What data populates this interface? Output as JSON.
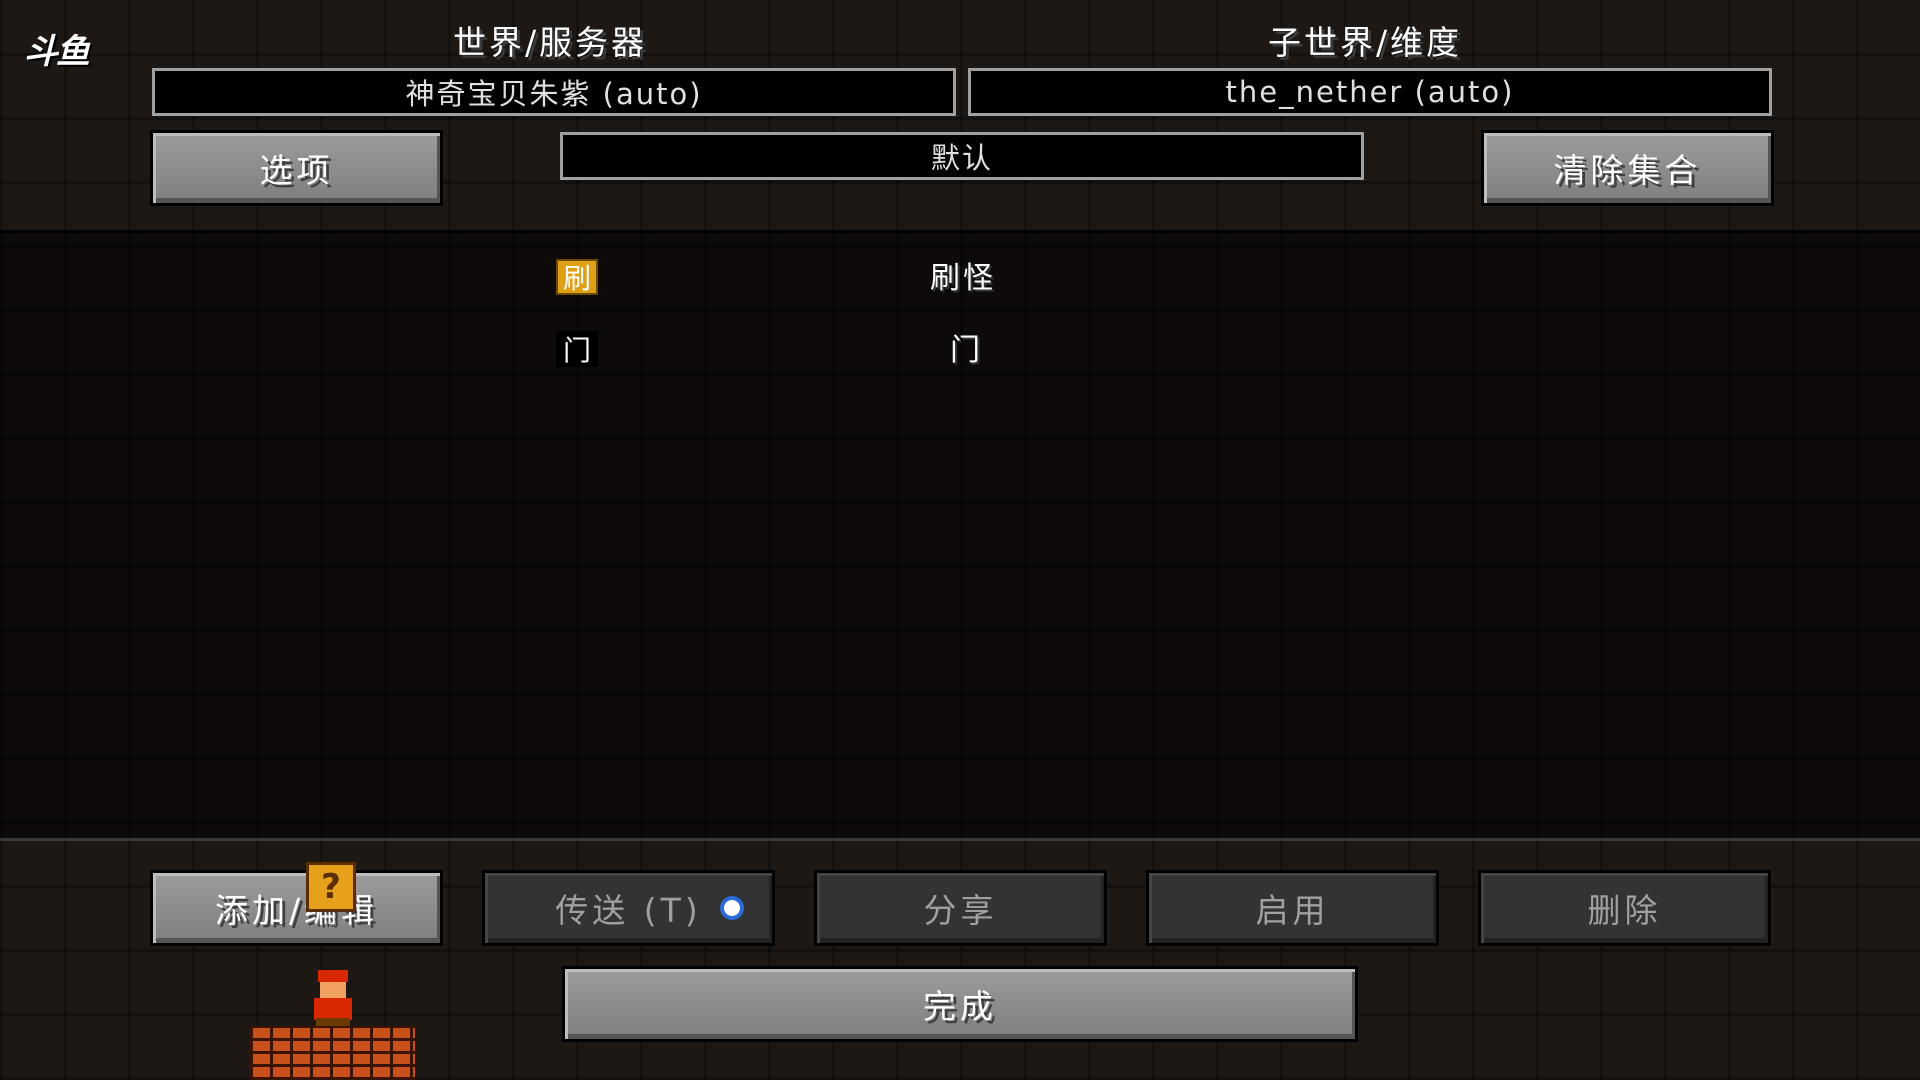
{
  "logo": {
    "text": "斗鱼"
  },
  "world_server": {
    "title": "世界/服务器",
    "value": "神奇宝贝朱紫 (auto)"
  },
  "sub_world": {
    "title": "子世界/维度",
    "value": "the_nether (auto)"
  },
  "options_button": {
    "label": "选项"
  },
  "set_field": {
    "value": "默认"
  },
  "clear_set_button": {
    "label": "清除集合"
  },
  "entries": [
    {
      "key": "刷",
      "name": "刷怪",
      "selected": true
    },
    {
      "key": "门",
      "name": "门",
      "selected": false
    }
  ],
  "buttons": {
    "add_edit": "添加/编辑",
    "teleport": "传送 (T)",
    "share": "分享",
    "enable": "启用",
    "delete": "删除",
    "done": "完成"
  },
  "overlay": {
    "question_mark": "?"
  },
  "colors": {
    "background": "#1d1814",
    "button_face": "#8c8c8c",
    "button_disabled": "#333333",
    "selected_key": "#e0a016",
    "radio_accent": "#2a6bd8"
  }
}
